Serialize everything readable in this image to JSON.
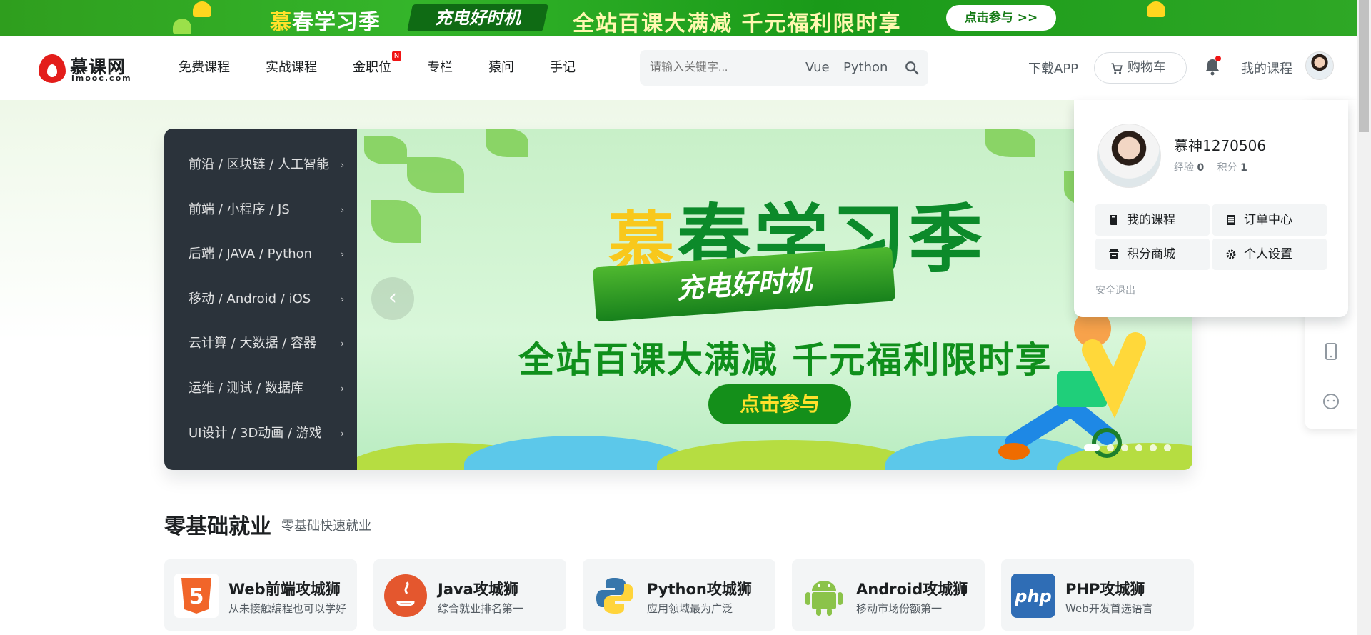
{
  "promo": {
    "title_mu": "慕",
    "title_rest": "春学习季",
    "ribbon": "充电好时机",
    "slogan": "全站百课大满减 千元福利限时享",
    "cta": "点击参与 >>"
  },
  "header": {
    "logo_cn": "慕课网",
    "logo_en": "imooc.com",
    "nav": [
      "免费课程",
      "实战课程",
      "金职位",
      "专栏",
      "猿问",
      "手记"
    ],
    "nav_new_badge": "N",
    "search_placeholder": "请输入关键字...",
    "hot_words": [
      "Vue",
      "Python"
    ],
    "download": "下载APP",
    "cart": "购物车",
    "my_courses": "我的课程"
  },
  "categories": [
    "前沿 / 区块链 / 人工智能",
    "前端 / 小程序 / JS",
    "后端 / JAVA / Python",
    "移动 / Android / iOS",
    "云计算 / 大数据 / 容器",
    "运维 / 测试 / 数据库",
    "UI设计 / 3D动画 / 游戏"
  ],
  "banner": {
    "title_mu": "慕",
    "title_rest": "春学习季",
    "ribbon": "充电好时机",
    "slogan": "全站百课大满减  千元福利限时享",
    "button": "点击参与",
    "prev": "‹"
  },
  "user_menu": {
    "username": "慕神1270506",
    "exp_label": "经验",
    "exp_value": "0",
    "points_label": "积分",
    "points_value": "1",
    "items": [
      {
        "label": "我的课程",
        "icon": "book-icon"
      },
      {
        "label": "订单中心",
        "icon": "order-icon"
      },
      {
        "label": "积分商城",
        "icon": "store-icon"
      },
      {
        "label": "个人设置",
        "icon": "gear-icon"
      }
    ],
    "logout": "安全退出"
  },
  "section": {
    "title": "零基础就业",
    "subtitle": "零基础快速就业",
    "cards": [
      {
        "title": "Web前端攻城狮",
        "desc": "从未接触编程也可以学好",
        "icon": "html5-icon",
        "color": "#f16529"
      },
      {
        "title": "Java攻城狮",
        "desc": "综合就业排名第一",
        "icon": "java-icon",
        "color": "#e76f00"
      },
      {
        "title": "Python攻城狮",
        "desc": "应用领域最为广泛",
        "icon": "python-icon",
        "color": "#3776ab"
      },
      {
        "title": "Android攻城狮",
        "desc": "移动市场份额第一",
        "icon": "android-icon",
        "color": "#8bc34a"
      },
      {
        "title": "PHP攻城狮",
        "desc": "Web开发首选语言",
        "icon": "php-icon",
        "color": "#2f6db5"
      }
    ]
  }
}
